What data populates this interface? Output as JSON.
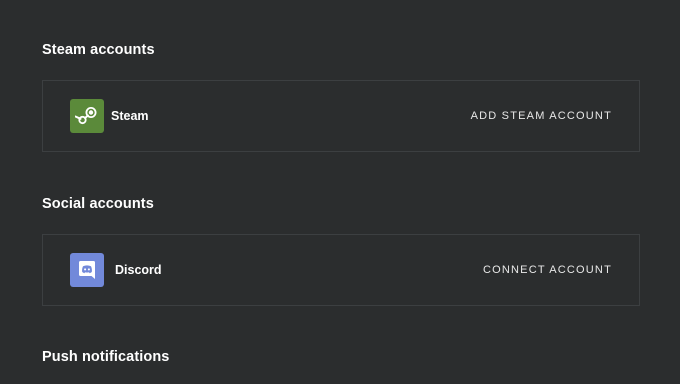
{
  "sections": {
    "steam": {
      "title": "Steam accounts",
      "service": {
        "name": "Steam",
        "icon": "steam-icon",
        "icon_bg": "#5b8a3a",
        "action_label": "ADD STEAM ACCOUNT"
      }
    },
    "social": {
      "title": "Social accounts",
      "service": {
        "name": "Discord",
        "icon": "discord-icon",
        "icon_bg": "#7289da",
        "action_label": "CONNECT ACCOUNT"
      }
    },
    "push": {
      "title": "Push notifications"
    }
  },
  "colors": {
    "background": "#2b2d2e",
    "card_border": "#3c3f41",
    "text": "#ffffff"
  }
}
